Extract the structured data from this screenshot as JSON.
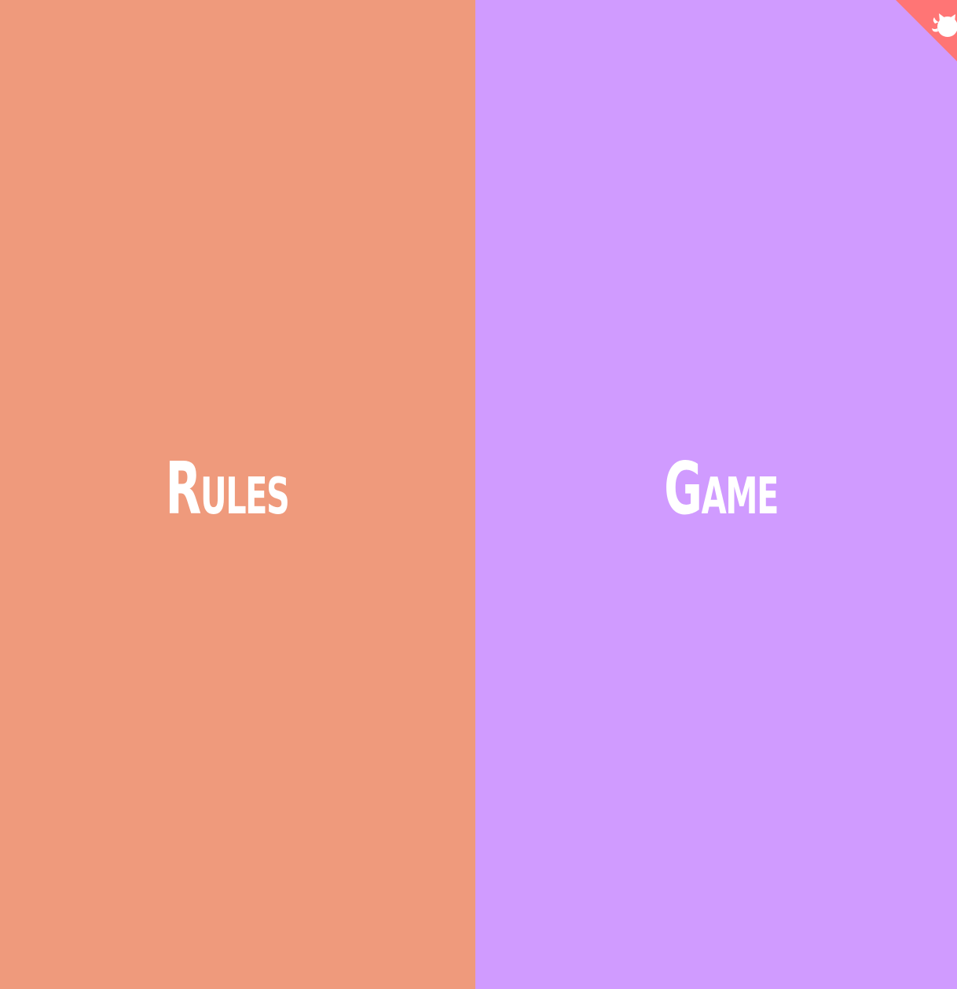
{
  "panels": {
    "rules": {
      "label": "Rules",
      "color": "#ef9a7c"
    },
    "game": {
      "label": "Game",
      "color": "#d09bff"
    }
  },
  "corner": {
    "icon": "github-octocat-icon",
    "color": "#ff7575",
    "icon_color": "#ffffff"
  }
}
